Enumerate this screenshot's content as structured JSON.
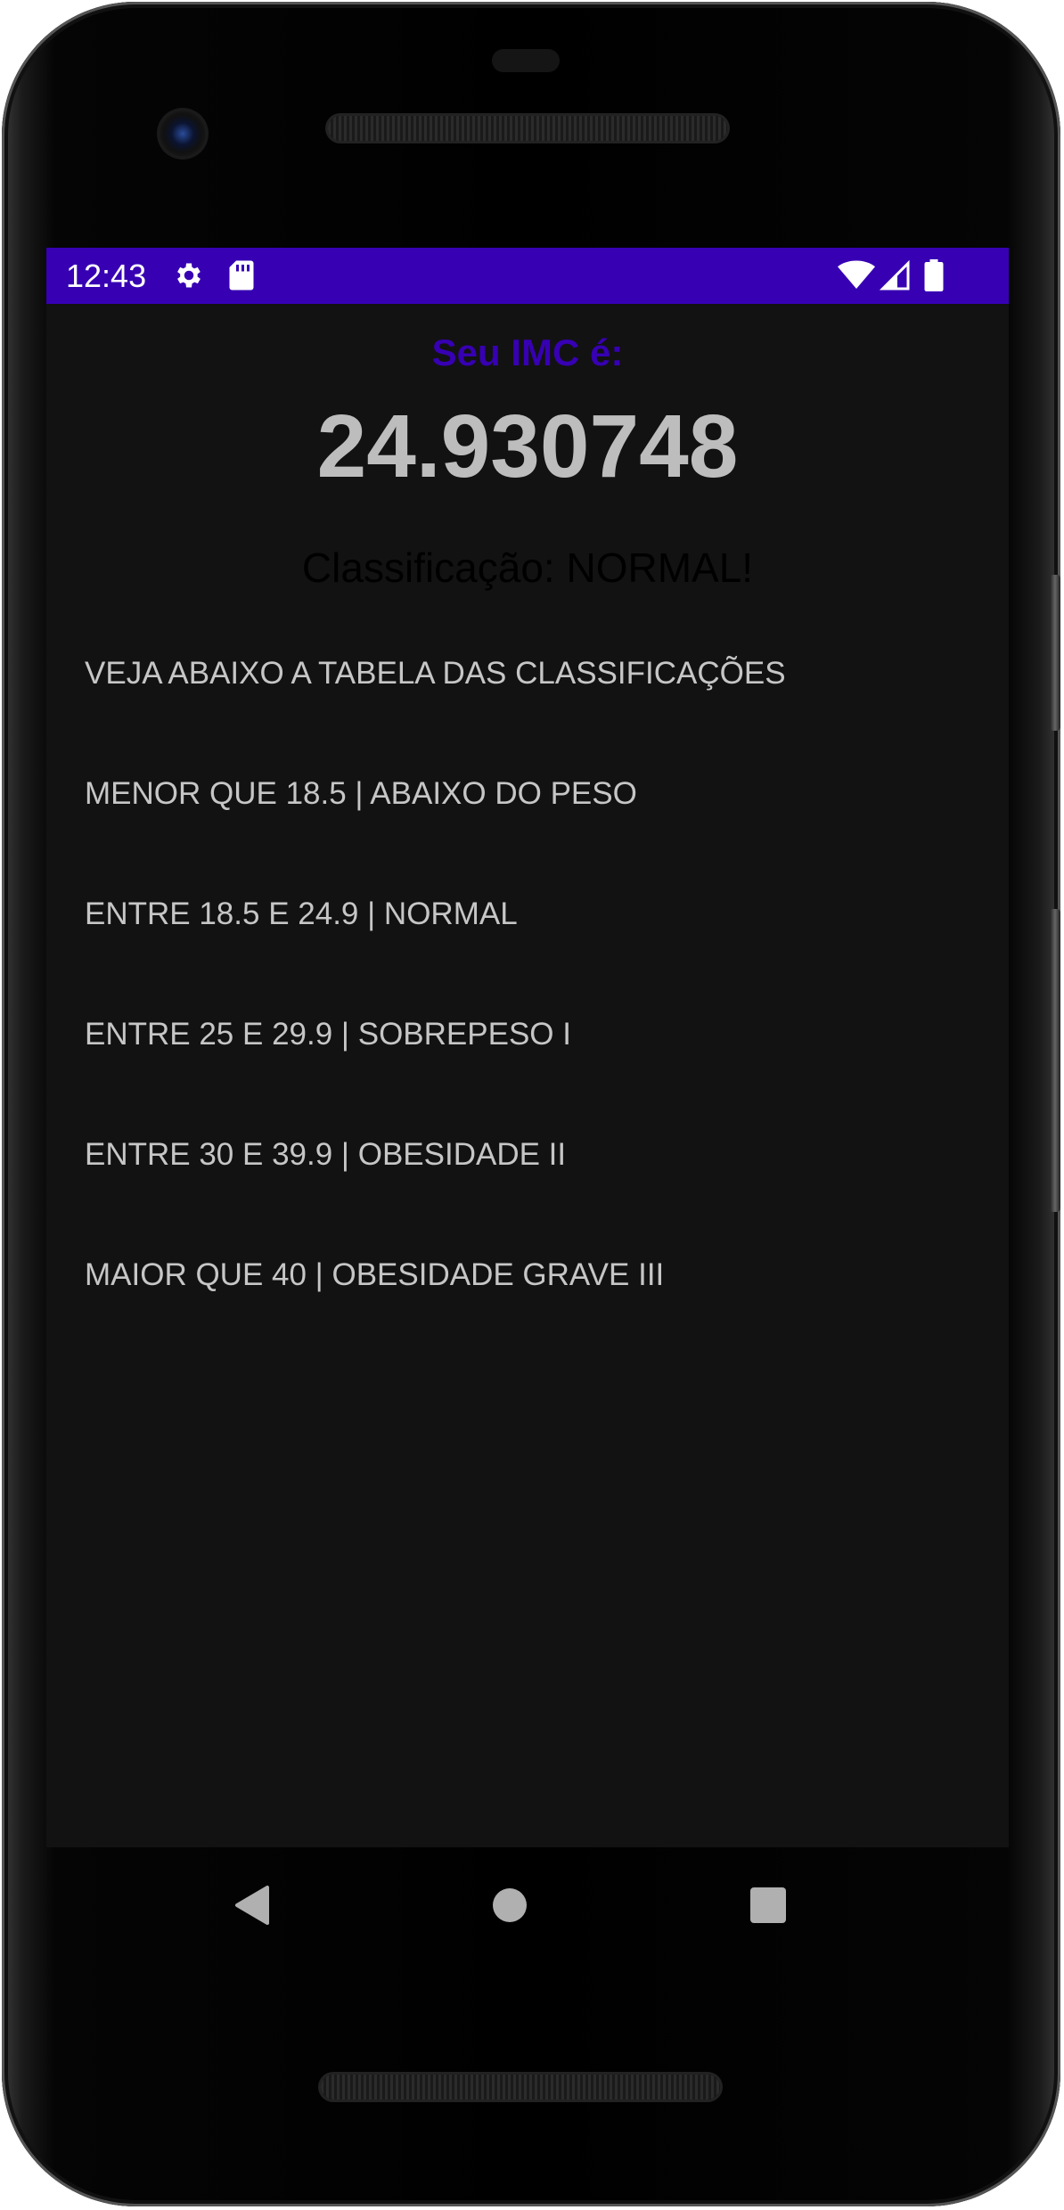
{
  "status_bar": {
    "time": "12:43",
    "background_color": "#3700b3",
    "icons": [
      "gear-icon",
      "sd-card-icon",
      "wifi-icon",
      "signal-icon",
      "battery-icon"
    ]
  },
  "result": {
    "title": "Seu IMC é:",
    "title_color": "#3700b3",
    "value": "24.930748",
    "classification": "Classificação: NORMAL!"
  },
  "table": {
    "heading": "VEJA ABAIXO A TABELA DAS CLASSIFICAÇÕES",
    "rows": [
      "MENOR QUE 18.5 | ABAIXO DO PESO",
      "ENTRE 18.5 E 24.9 | NORMAL",
      "ENTRE 25 E 29.9 | SOBREPESO I",
      "ENTRE 30 E 39.9 | OBESIDADE II",
      "MAIOR QUE 40 | OBESIDADE GRAVE III"
    ]
  },
  "nav_bar": {
    "icons": [
      "back-icon",
      "home-icon",
      "recent-apps-icon"
    ]
  },
  "colors": {
    "screen_background": "#121212",
    "text_secondary": "#c6c6c6"
  }
}
